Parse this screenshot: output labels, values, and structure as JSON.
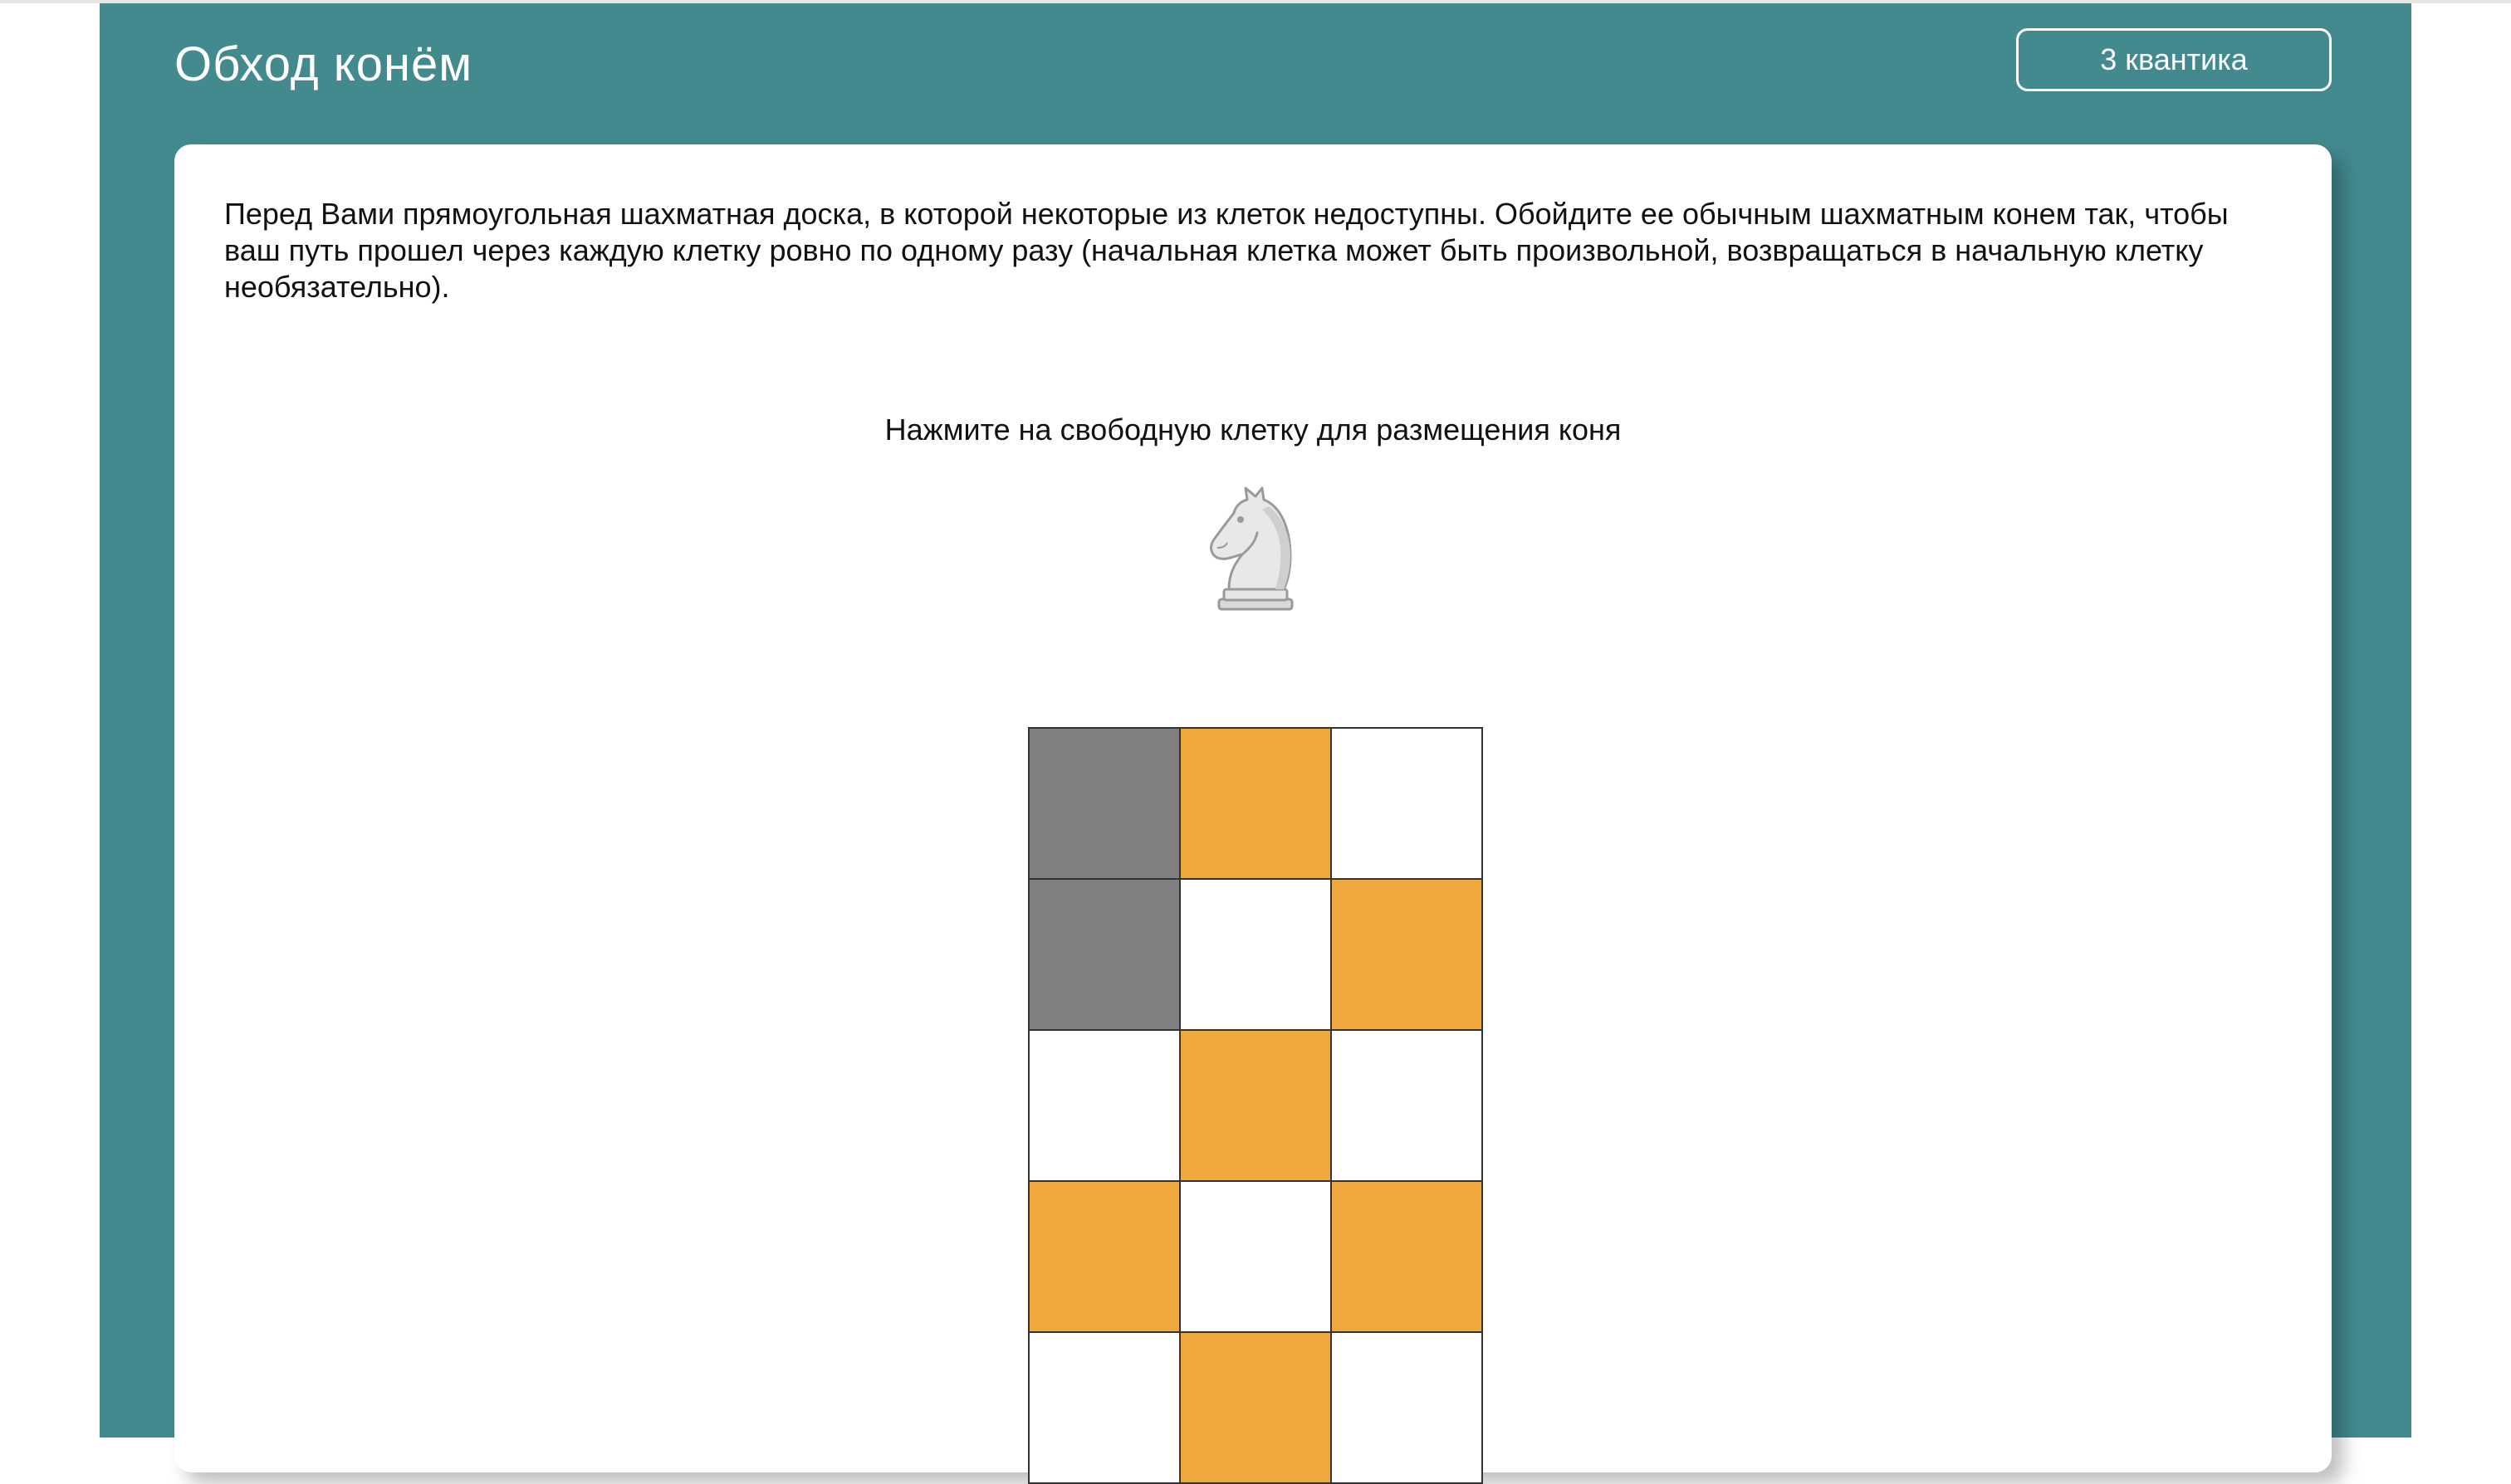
{
  "header": {
    "title": "Обход конём",
    "quanta_button_label": "3 квантика"
  },
  "task": {
    "description": "Перед Вами прямоугольная шахматная доска, в которой некоторые из клеток недоступны. Обойдите ее обычным шахматным конем так, чтобы ваш путь прошел через каждую клетку ровно по одному разу (начальная клетка может быть произвольной, возвращаться в начальную клетку необязательно).",
    "instruction": "Нажмите на свободную клетку для размещения коня"
  },
  "knight_piece": {
    "icon": "chess-knight-icon"
  },
  "board": {
    "columns": 3,
    "rows_visible": 5,
    "cells": [
      [
        "blocked",
        "orange",
        "white"
      ],
      [
        "blocked",
        "white",
        "orange"
      ],
      [
        "white",
        "orange",
        "white"
      ],
      [
        "orange",
        "white",
        "orange"
      ],
      [
        "white",
        "orange",
        "white"
      ]
    ],
    "colors": {
      "blocked": "#808080",
      "orange": "#f0a83c",
      "white": "#ffffff"
    }
  },
  "colors": {
    "panel": "#438a8f",
    "card": "#ffffff",
    "text": "#111111"
  }
}
